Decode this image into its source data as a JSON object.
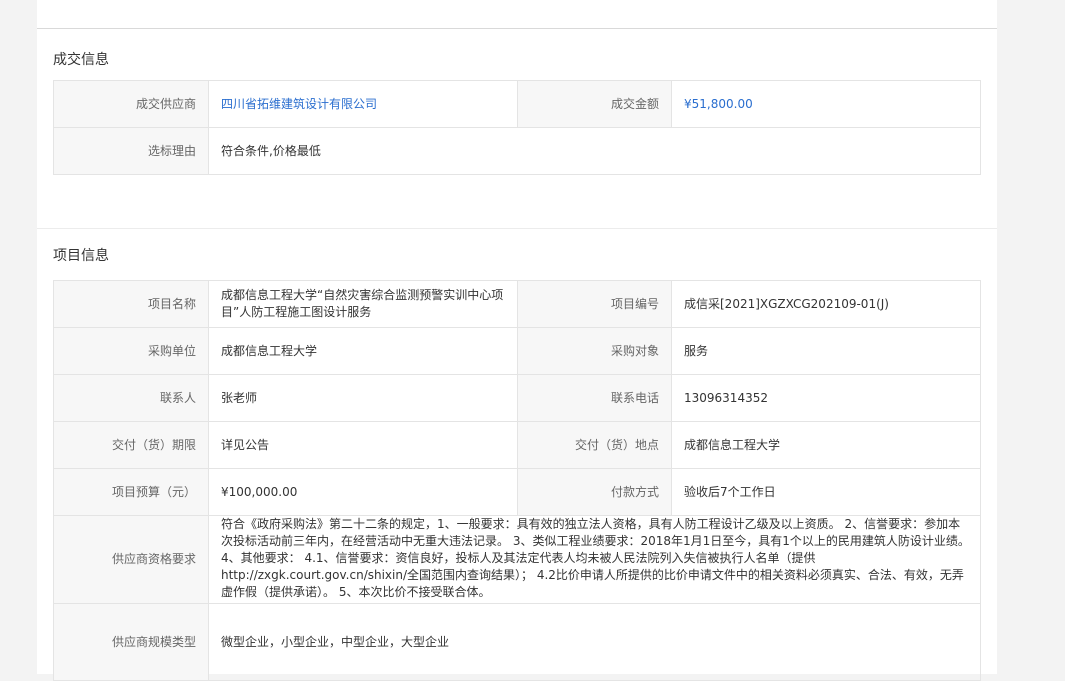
{
  "deal": {
    "title": "成交信息",
    "supplier_label": "成交供应商",
    "supplier_value": "四川省拓维建筑设计有限公司",
    "amount_label": "成交金额",
    "amount_value": "¥51,800.00",
    "reason_label": "选标理由",
    "reason_value": "符合条件,价格最低"
  },
  "project": {
    "title": "项目信息",
    "name_label": "项目名称",
    "name_value": "成都信息工程大学“自然灾害综合监测预警实训中心项目”人防工程施工图设计服务",
    "code_label": "项目编号",
    "code_value": "成信采[2021]XGZXCG202109-01(J)",
    "buyer_label": "采购单位",
    "buyer_value": "成都信息工程大学",
    "object_label": "采购对象",
    "object_value": "服务",
    "contact_label": "联系人",
    "contact_value": "张老师",
    "phone_label": "联系电话",
    "phone_value": "13096314352",
    "period_label": "交付（货）期限",
    "period_value": "详见公告",
    "place_label": "交付（货）地点",
    "place_value": "成都信息工程大学",
    "budget_label": "项目预算（元）",
    "budget_value": "¥100,000.00",
    "payment_label": "付款方式",
    "payment_value": "验收后7个工作日",
    "qualification_label": "供应商资格要求",
    "qualification_value": "符合《政府采购法》第二十二条的规定，1、一般要求：具有效的独立法人资格，具有人防工程设计乙级及以上资质。 2、信誉要求：参加本次投标活动前三年内，在经营活动中无重大违法记录。 3、类似工程业绩要求：2018年1月1日至今，具有1个以上的民用建筑人防设计业绩。 4、其他要求： 4.1、信誉要求：资信良好，投标人及其法定代表人均未被人民法院列入失信被执行人名单（提供http://zxgk.court.gov.cn/shixin/全国范围内查询结果）； 4.2比价申请人所提供的比价申请文件中的相关资料必须真实、合法、有效，无弄虚作假（提供承诺）。 5、本次比价不接受联合体。",
    "scale_label": "供应商规模类型",
    "scale_value": "微型企业，小型企业，中型企业，大型企业"
  }
}
